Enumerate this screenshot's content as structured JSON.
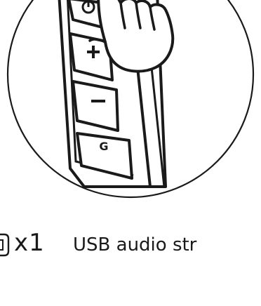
{
  "illustration": {
    "buttons": [
      {
        "icon": "power-icon",
        "label": ""
      },
      {
        "icon": "plus-icon",
        "label": "+"
      },
      {
        "icon": "minus-icon",
        "label": "−"
      },
      {
        "icon": "g-key",
        "label": "G"
      }
    ]
  },
  "caption": {
    "quantity": "x1",
    "item_name": "USB audio str"
  },
  "colors": {
    "ink": "#1a1a1a",
    "background": "#ffffff"
  }
}
